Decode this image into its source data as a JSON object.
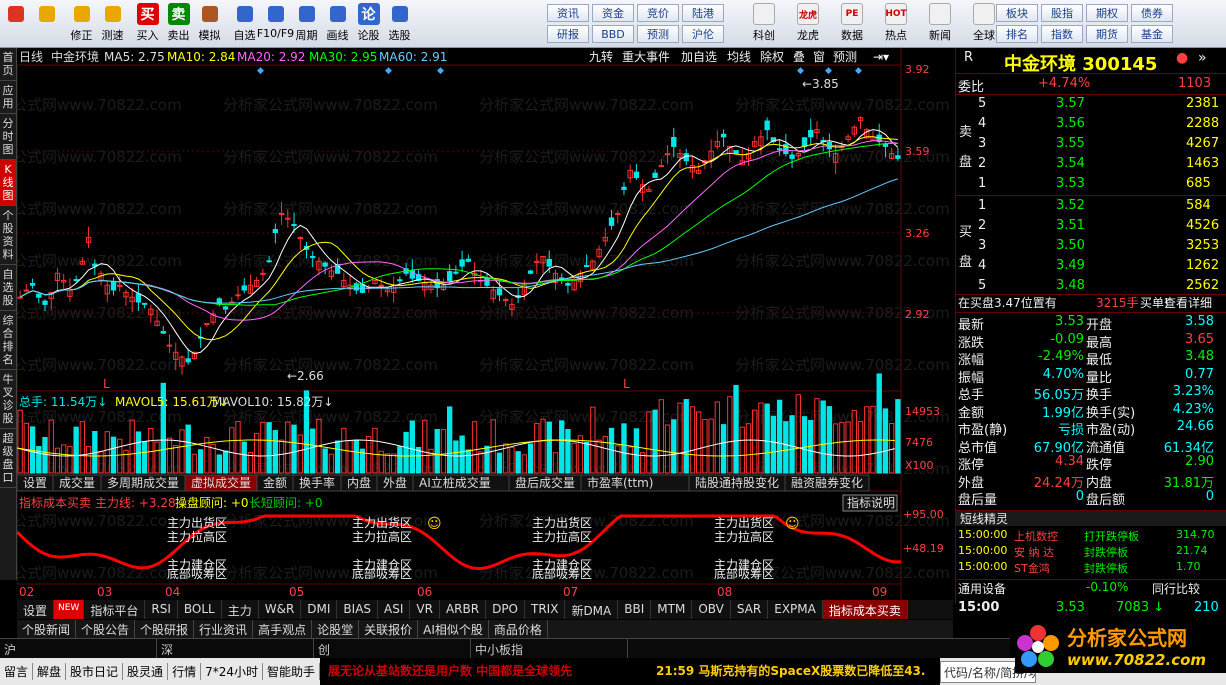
{
  "toolbar": {
    "buttons": [
      {
        "label": "",
        "icon": "grid-icon",
        "color": "#d32"
      },
      {
        "label": "",
        "icon": "back-arrow-icon",
        "color": "#e8a800"
      },
      {
        "label": "修正",
        "icon": "up-arrow-icon",
        "color": "#e8a800"
      },
      {
        "label": "测速",
        "icon": "clock-icon",
        "color": "#e8a800"
      },
      {
        "label": "买入",
        "icon": "buy-icon",
        "color": "#d00",
        "glyph": "买"
      },
      {
        "label": "卖出",
        "icon": "sell-icon",
        "color": "#080",
        "glyph": "卖"
      },
      {
        "label": "模拟",
        "icon": "hammer-icon",
        "color": "#a52"
      },
      {
        "label": "自选",
        "icon": "folder-icon",
        "color": "#36c"
      },
      {
        "label": "F10/F9",
        "icon": "f10-icon",
        "color": "#36c"
      },
      {
        "label": "周期",
        "icon": "cycle-icon",
        "color": "#36c"
      },
      {
        "label": "画线",
        "icon": "pen-icon",
        "color": "#36c"
      },
      {
        "label": "论股",
        "icon": "forum-icon",
        "color": "#36c",
        "glyph": "论"
      },
      {
        "label": "选股",
        "icon": "search-chart-icon",
        "color": "#36c"
      }
    ],
    "grid_buttons": [
      [
        "资讯",
        "资金",
        "竞价",
        "陆港"
      ],
      [
        "研报",
        "BBD",
        "预测",
        "沪伦"
      ]
    ],
    "right_buttons": [
      {
        "label": "科创",
        "icon": "kechuang-icon"
      },
      {
        "label": "龙虎",
        "icon": "dragon-icon",
        "glyph": "龙虎"
      },
      {
        "label": "数据",
        "icon": "pe-icon",
        "glyph": "PE"
      },
      {
        "label": "热点",
        "icon": "hot-icon",
        "glyph": "HOT"
      },
      {
        "label": "新闻",
        "icon": "news-icon"
      },
      {
        "label": "全球",
        "icon": "globe-icon"
      }
    ],
    "grid_buttons2": [
      [
        "板块",
        "股指",
        "期权",
        "债券"
      ],
      [
        "排名",
        "指数",
        "期货",
        "基金"
      ]
    ]
  },
  "leftnav": [
    "首页",
    "应用",
    "分时图",
    "K线图",
    "个股资料",
    "自选股",
    "综合排名",
    "牛叉诊股",
    "超级盘口"
  ],
  "chart_header": {
    "period": "日线",
    "name": "中金环境",
    "ma5": "MA5: 2.75",
    "ma10": "MA10: 2.84",
    "ma20": "MA20: 2.92",
    "ma30": "MA30: 2.95",
    "ma60": "MA60: 2.91"
  },
  "chart_tools": [
    "九转",
    "重大事件",
    "加自选",
    "均线",
    "除权",
    "叠",
    "窗",
    "预测"
  ],
  "price_axis": [
    "3.92",
    "3.59",
    "3.26",
    "2.92"
  ],
  "vol_axis": [
    "14953",
    "7476",
    "X100"
  ],
  "ind_axis": [
    "+95.00",
    "+48.19"
  ],
  "price_labels": {
    "high": "3.85",
    "low": "2.66"
  },
  "vol_header": {
    "total": "总手: 11.54万",
    "mavol5": "MAVOL5: 15.61万",
    "mavol10": "MAVOL10: 15.82万"
  },
  "sub_tabs": [
    "设置",
    "成交量",
    "多周期成交量",
    "虚拟成交量",
    "金额",
    "换手率",
    "内盘",
    "外盘",
    "AI立桩成交量",
    "盘后成交量",
    "市盈率(ttm)",
    "陆股通持股变化",
    "融资融券变化"
  ],
  "ind_header": {
    "name": "指标成本买卖",
    "mainline": "主力线: +3.28",
    "op": "操盘顾问: +0",
    "long": "长短顾问: +0",
    "explain": "指标说明"
  },
  "ind_labels": [
    "主力出货区",
    "主力拉高区",
    "主力建仓区",
    "底部吸筹区"
  ],
  "months": [
    "02",
    "03",
    "04",
    "05",
    "06",
    "07",
    "08",
    "09"
  ],
  "watermark": "分析家公式网www.70822.com",
  "bottom_tabs": [
    "设置",
    "NEW",
    "指标平台",
    "RSI",
    "BOLL",
    "主力",
    "W&R",
    "DMI",
    "BIAS",
    "ASI",
    "VR",
    "ARBR",
    "DPO",
    "TRIX",
    "新DMA",
    "BBI",
    "MTM",
    "OBV",
    "SAR",
    "EXPMA",
    "指标成本买卖"
  ],
  "news_tabs": [
    "个股新闻",
    "个股公告",
    "个股研报",
    "行业资讯",
    "高手观点",
    "论股堂",
    "关联报价",
    "AI相似个股",
    "商品价格"
  ],
  "index_bar": [
    "沪",
    "深",
    "创",
    "中小板指"
  ],
  "status": [
    "留言",
    "解盘",
    "股市日记",
    "股灵通",
    "行情",
    "7*24小时",
    "智能助手"
  ],
  "ticker": "展无论从基站数还是用户数 中国都是全球领先",
  "ticker_time": "21:59 马斯克持有的SpaceX股票数已降低至43.",
  "search_hint": "代码/名称/简拼/功",
  "ad_text": "分析家公式网",
  "ad_url": "www.70822.com",
  "quote": {
    "title": "中金环境",
    "code": "300145",
    "weibi_label": "委比",
    "weibi": "+4.74%",
    "weicha": "1103",
    "sell": [
      [
        "5",
        "3.57",
        "2381"
      ],
      [
        "4",
        "3.56",
        "2288"
      ],
      [
        "3",
        "3.55",
        "4267"
      ],
      [
        "2",
        "3.54",
        "1463"
      ],
      [
        "1",
        "3.53",
        "685"
      ]
    ],
    "buy": [
      [
        "1",
        "3.52",
        "584"
      ],
      [
        "2",
        "3.51",
        "4526"
      ],
      [
        "3",
        "3.50",
        "3253"
      ],
      [
        "4",
        "3.49",
        "1262"
      ],
      [
        "5",
        "3.48",
        "2562"
      ]
    ],
    "sell_side": "卖盘",
    "buy_side": "买盘",
    "bid_note": "在买盘3.47位置有",
    "bid_vol": "3215手",
    "bid_act": "买单!",
    "detail": "查看详细",
    "stats": [
      [
        "最新",
        "3.53",
        "开盘",
        "3.58"
      ],
      [
        "涨跌",
        "-0.09",
        "最高",
        "3.65"
      ],
      [
        "涨幅",
        "-2.49%",
        "最低",
        "3.48"
      ],
      [
        "振幅",
        "4.70%",
        "量比",
        "0.77"
      ],
      [
        "总手",
        "56.05万",
        "换手",
        "3.23%"
      ],
      [
        "金额",
        "1.99亿",
        "换手(实)",
        "4.23%"
      ],
      [
        "市盈(静)",
        "亏损",
        "市盈(动)",
        "24.66"
      ],
      [
        "总市值",
        "67.90亿",
        "流通值",
        "61.34亿"
      ],
      [
        "涨停",
        "4.34",
        "跌停",
        "2.90"
      ],
      [
        "外盘",
        "24.24万",
        "内盘",
        "31.81万"
      ],
      [
        "盘后量",
        "0",
        "盘后额",
        "0"
      ]
    ],
    "short_title": "短线精灵",
    "short": [
      [
        "15:00:00",
        "上机数控",
        "打开跌停板",
        "314.70"
      ],
      [
        "15:00:00",
        "安 纳 达",
        "封跌停板",
        "21.74"
      ],
      [
        "15:00:00",
        "ST金鸿",
        "封跌停板",
        "1.70"
      ]
    ],
    "compare": [
      "通用设备",
      "-0.10%",
      "同行比较"
    ],
    "tick": [
      "15:00",
      "3.53",
      "7083",
      "210"
    ]
  },
  "chart_data": {
    "type": "candlestick",
    "note": "K-line daily chart of 中金环境 300145, approx price range 2.66-3.85"
  }
}
